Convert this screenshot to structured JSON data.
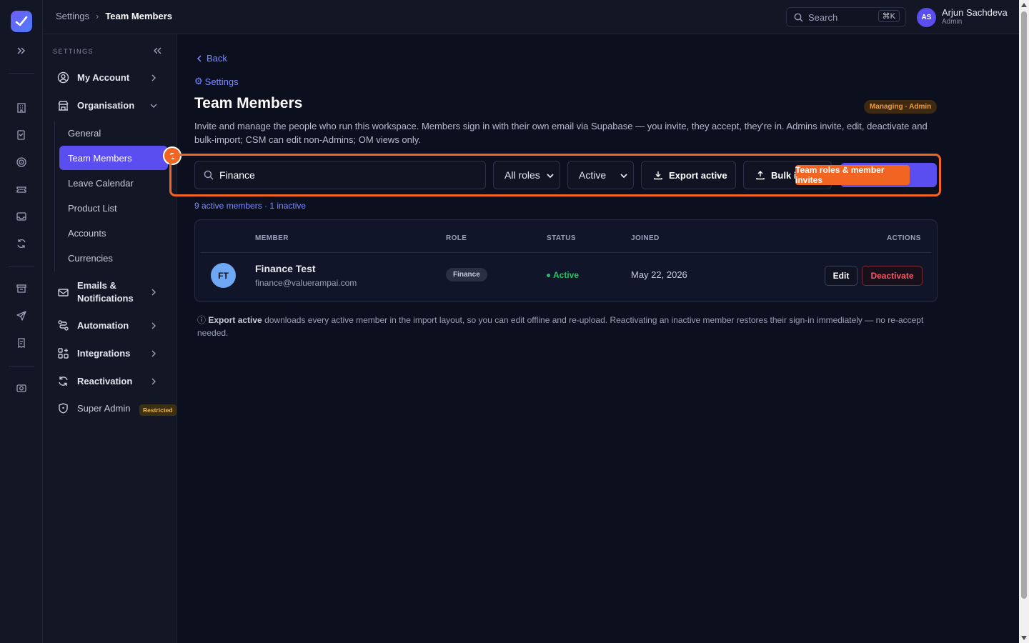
{
  "topbar": {
    "breadcrumb": [
      "Settings",
      "Team Members"
    ],
    "search_placeholder": "Search",
    "search_shortcut": "⌘K",
    "user_initials": "AS",
    "user_name": "Arjun Sachdeva",
    "user_role": "Admin"
  },
  "rail": {
    "icons": [
      "building-icon",
      "clipboard-check-icon",
      "target-icon",
      "ticket-icon",
      "inbox-icon",
      "refresh-icon",
      "archive-icon",
      "send-icon",
      "receipt-icon",
      "camera-icon"
    ]
  },
  "sidebar": {
    "header": "SETTINGS",
    "items": [
      {
        "label": "My Account"
      },
      {
        "label": "Organisation"
      },
      {
        "label": "Emails & Notifications"
      },
      {
        "label": "Automation"
      },
      {
        "label": "Integrations"
      },
      {
        "label": "Reactivation"
      },
      {
        "label": "Super Admin",
        "badge": "Restricted"
      }
    ],
    "organisation_sub": [
      "General",
      "Team Members",
      "Leave Calendar",
      "Product List",
      "Accounts",
      "Currencies"
    ],
    "step_badge": "2"
  },
  "main": {
    "back_label": "Back",
    "settings_link": "Settings",
    "title": "Team Members",
    "managing_badge": "Managing · Admin",
    "description": "Invite and manage the people who run this workspace. Members sign in with their own email via Supabase — you invite, they accept, they're in. Admins invite, edit, deactivate and bulk-import; CSM can edit non-Admins; OM views only.",
    "search_value": "Finance",
    "role_filter": "All roles",
    "status_filter": "Active",
    "export_label": "Export active",
    "bulk_label": "Bulk i",
    "tooltip": "Team roles & member invites",
    "count_text": "9 active members · 1 inactive",
    "table": {
      "headers": [
        "MEMBER",
        "ROLE",
        "STATUS",
        "JOINED",
        "ACTIONS"
      ],
      "rows": [
        {
          "initials": "FT",
          "name": "Finance Test",
          "email": "finance@valuerampai.com",
          "role": "Finance",
          "status": "Active",
          "joined": "May 22, 2026",
          "edit": "Edit",
          "deactivate": "Deactivate"
        }
      ]
    },
    "note_bold": "Export active",
    "note_rest": " downloads every active member in the import layout, so you can edit offline and re-upload. Reactivating an inactive member restores their sign-in immediately — no re-accept needed."
  }
}
